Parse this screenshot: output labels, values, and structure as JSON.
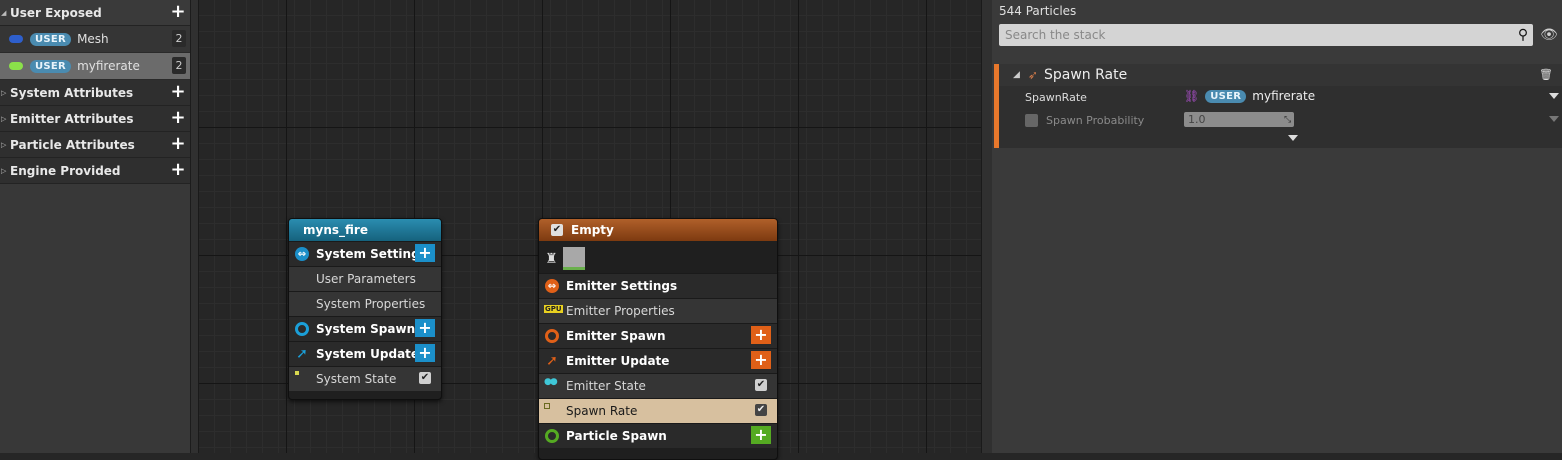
{
  "sidebar": {
    "user_exposed": {
      "label": "User Exposed"
    },
    "params": [
      {
        "pill": "USER",
        "name": "Mesh",
        "count": "2",
        "color": "#2e5fcc"
      },
      {
        "pill": "USER",
        "name": "myfirerate",
        "count": "2",
        "color": "#8be04a"
      }
    ],
    "categories": [
      {
        "label": "System Attributes"
      },
      {
        "label": "Emitter Attributes"
      },
      {
        "label": "Particle Attributes"
      },
      {
        "label": "Engine Provided"
      }
    ]
  },
  "system_node": {
    "title": "myns_fire",
    "rows": {
      "system_settings": "System Settings",
      "user_parameters": "User Parameters",
      "system_properties": "System Properties",
      "system_spawn": "System Spawn",
      "system_update": "System Update",
      "system_state": "System State"
    }
  },
  "emitter_node": {
    "title": "Empty",
    "rows": {
      "emitter_settings": "Emitter Settings",
      "gpu_badge": "GPU",
      "emitter_properties": "Emitter Properties",
      "emitter_spawn": "Emitter Spawn",
      "emitter_update": "Emitter Update",
      "emitter_state": "Emitter State",
      "spawn_rate": "Spawn Rate",
      "particle_spawn": "Particle Spawn"
    }
  },
  "stack": {
    "particle_count": "544 Particles",
    "search_placeholder": "Search the stack",
    "module_title": "Spawn Rate",
    "spawnrate_label": "SpawnRate",
    "spawnrate_pill": "USER",
    "spawnrate_value": "myfirerate",
    "probability_label": "Spawn Probability",
    "probability_value": "1.0"
  },
  "colors": {
    "system_header": "#1f7a98",
    "emitter_header": "#9a4a12",
    "accent_orange": "#e8782c",
    "add_blue": "#1b8fc9",
    "add_orange": "#e06018",
    "add_green": "#55aa22",
    "selected_row": "#d7c09f"
  }
}
